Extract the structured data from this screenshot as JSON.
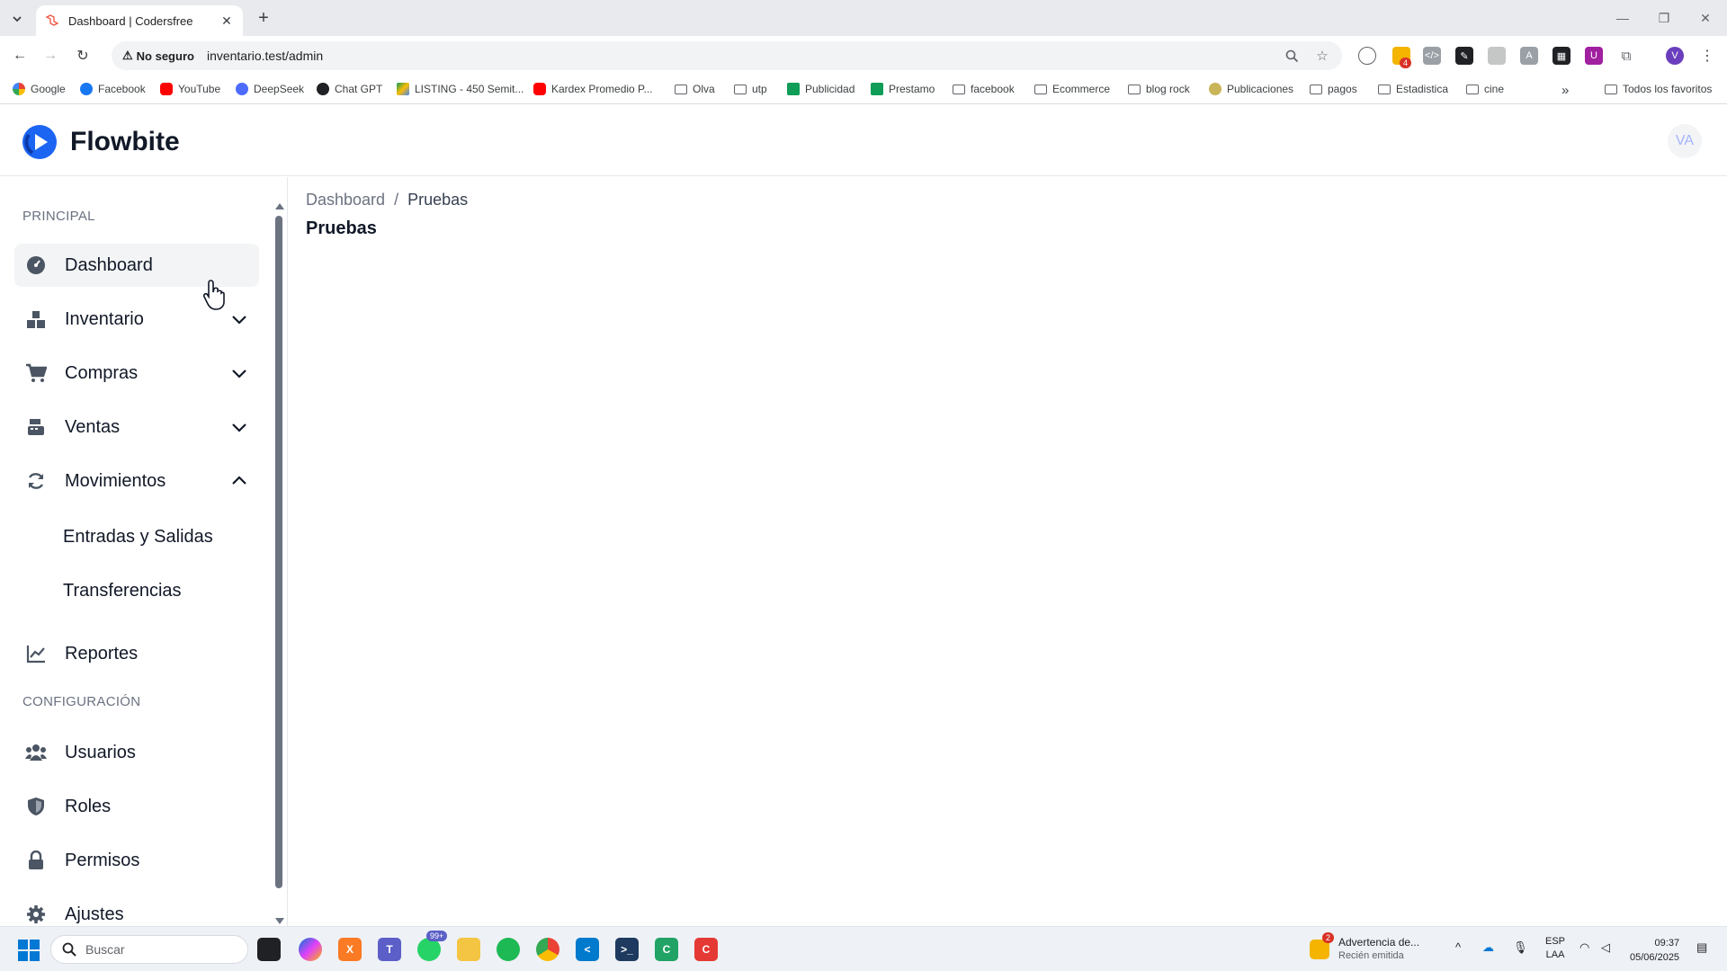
{
  "browser": {
    "tab_title": "Dashboard | Codersfree",
    "security_label": "No seguro",
    "url": "inventario.test/admin",
    "profile_initial": "V",
    "ext_badge": "4"
  },
  "bookmarks": [
    "Google",
    "Facebook",
    "YouTube",
    "DeepSeek",
    "Chat GPT",
    "LISTING - 450 Semit...",
    "Kardex Promedio P...",
    "Olva",
    "utp",
    "Publicidad",
    "Prestamo",
    "facebook",
    "Ecommerce",
    "blog rock",
    "Publicaciones",
    "pagos",
    "Estadistica",
    "cine"
  ],
  "bookmarks_more": "»",
  "bookmarks_all": "Todos los favoritos",
  "app": {
    "brand": "Flowbite",
    "avatar_initials": "VA"
  },
  "sidebar": {
    "section_principal": "PRINCIPAL",
    "section_config": "CONFIGURACIÓN",
    "items": [
      {
        "label": "Dashboard"
      },
      {
        "label": "Inventario"
      },
      {
        "label": "Compras"
      },
      {
        "label": "Ventas"
      },
      {
        "label": "Movimientos"
      },
      {
        "label": "Reportes"
      },
      {
        "label": "Usuarios"
      },
      {
        "label": "Roles"
      },
      {
        "label": "Permisos"
      },
      {
        "label": "Ajustes"
      }
    ],
    "subitems": [
      {
        "label": "Entradas y Salidas"
      },
      {
        "label": "Transferencias"
      }
    ]
  },
  "main": {
    "breadcrumb_root": "Dashboard",
    "breadcrumb_sep": "/",
    "breadcrumb_current": "Pruebas",
    "title": "Pruebas"
  },
  "taskbar": {
    "search_placeholder": "Buscar",
    "whatsapp_badge": "99+",
    "notif_count": "2",
    "notif_title": "Advertencia de...",
    "notif_sub": "Recién emitida",
    "lang1": "ESP",
    "lang2": "LAA",
    "time": "09:37",
    "date": "05/06/2025"
  }
}
